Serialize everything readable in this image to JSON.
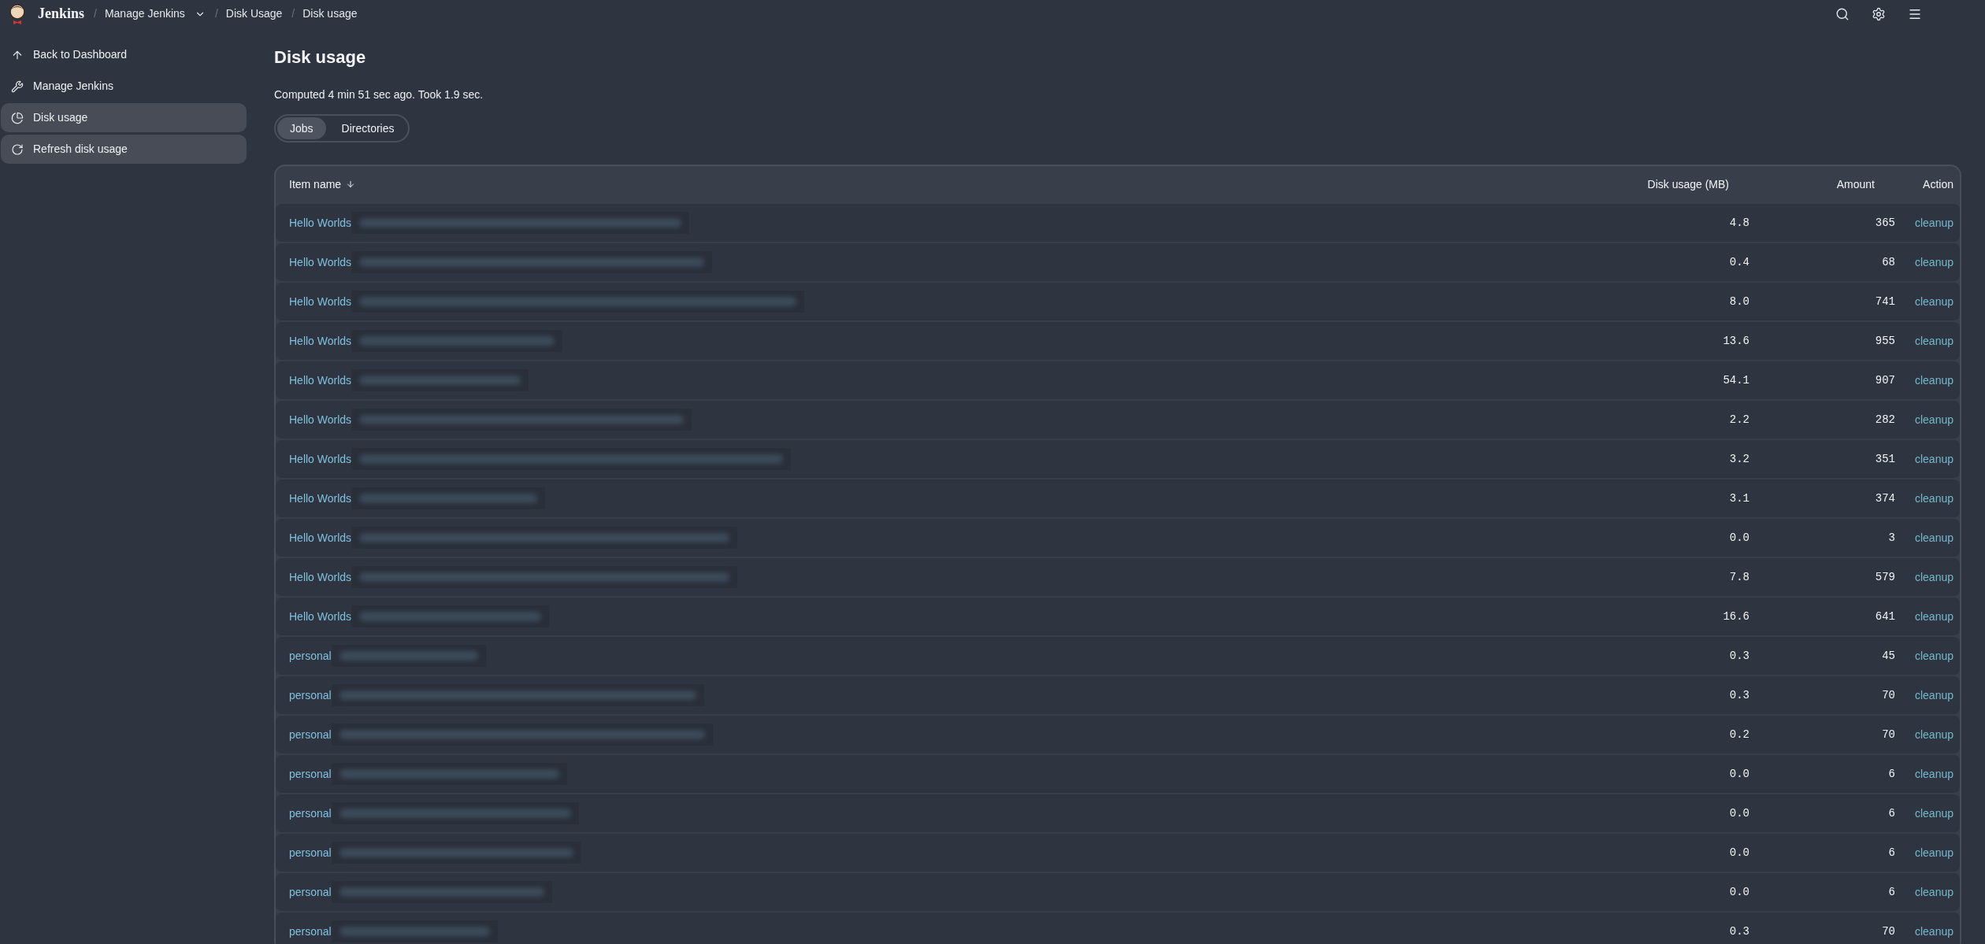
{
  "header": {
    "title": "Jenkins",
    "breadcrumbs": [
      {
        "separator": "/",
        "label": "Manage Jenkins",
        "dropdown": true
      },
      {
        "separator": "/",
        "label": "Disk Usage",
        "dropdown": false
      },
      {
        "separator": "/",
        "label": "Disk usage",
        "dropdown": false
      }
    ]
  },
  "sidebar": {
    "items": [
      {
        "kind": "back",
        "label": "Back to Dashboard",
        "selected": false
      },
      {
        "kind": "manage",
        "label": "Manage Jenkins",
        "selected": false
      },
      {
        "kind": "disk",
        "label": "Disk usage",
        "selected": true
      },
      {
        "kind": "refresh",
        "label": "Refresh disk usage",
        "selected": true
      }
    ]
  },
  "page": {
    "title": "Disk usage",
    "summary": "Computed 4 min 51 sec ago. Took 1.9 sec.",
    "tabs": [
      {
        "label": "Jobs",
        "selected": true
      },
      {
        "label": "Directories",
        "selected": false
      }
    ]
  },
  "table": {
    "columns": [
      {
        "kind": "name",
        "label": "Item name",
        "sorted": true
      },
      {
        "kind": "number",
        "label": "Disk usage (MB)",
        "sorted": false
      },
      {
        "kind": "number",
        "label": "Amount",
        "sorted": false
      },
      {
        "kind": "action",
        "label": "Action",
        "sorted": false
      }
    ],
    "rows": [
      {
        "name": "Hello Worlds",
        "redacted": true,
        "disk_usage": "4.8",
        "amount": "365",
        "action": "cleanup"
      },
      {
        "name": "Hello Worlds",
        "redacted": true,
        "disk_usage": "0.4",
        "amount": "68",
        "action": "cleanup"
      },
      {
        "name": "Hello Worlds",
        "redacted": true,
        "disk_usage": "8.0",
        "amount": "741",
        "action": "cleanup"
      },
      {
        "name": "Hello Worlds",
        "redacted": true,
        "disk_usage": "13.6",
        "amount": "955",
        "action": "cleanup"
      },
      {
        "name": "Hello Worlds",
        "redacted": true,
        "disk_usage": "54.1",
        "amount": "907",
        "action": "cleanup"
      },
      {
        "name": "Hello Worlds",
        "redacted": true,
        "disk_usage": "2.2",
        "amount": "282",
        "action": "cleanup"
      },
      {
        "name": "Hello Worlds",
        "redacted": true,
        "disk_usage": "3.2",
        "amount": "351",
        "action": "cleanup"
      },
      {
        "name": "Hello Worlds",
        "redacted": true,
        "disk_usage": "3.1",
        "amount": "374",
        "action": "cleanup"
      },
      {
        "name": "Hello Worlds",
        "redacted": true,
        "disk_usage": "0.0",
        "amount": "3",
        "action": "cleanup"
      },
      {
        "name": "Hello Worlds",
        "redacted": true,
        "disk_usage": "7.8",
        "amount": "579",
        "action": "cleanup"
      },
      {
        "name": "Hello Worlds",
        "redacted": true,
        "disk_usage": "16.6",
        "amount": "641",
        "action": "cleanup"
      },
      {
        "name": "personal",
        "redacted": true,
        "disk_usage": "0.3",
        "amount": "45",
        "action": "cleanup"
      },
      {
        "name": "personal",
        "redacted": true,
        "disk_usage": "0.3",
        "amount": "70",
        "action": "cleanup"
      },
      {
        "name": "personal",
        "redacted": true,
        "disk_usage": "0.2",
        "amount": "70",
        "action": "cleanup"
      },
      {
        "name": "personal",
        "redacted": true,
        "disk_usage": "0.0",
        "amount": "6",
        "action": "cleanup"
      },
      {
        "name": "personal",
        "redacted": true,
        "disk_usage": "0.0",
        "amount": "6",
        "action": "cleanup"
      },
      {
        "name": "personal",
        "redacted": true,
        "disk_usage": "0.0",
        "amount": "6",
        "action": "cleanup"
      },
      {
        "name": "personal",
        "redacted": true,
        "disk_usage": "0.0",
        "amount": "6",
        "action": "cleanup"
      },
      {
        "name": "personal",
        "redacted": true,
        "disk_usage": "0.3",
        "amount": "70",
        "action": "cleanup"
      }
    ]
  }
}
